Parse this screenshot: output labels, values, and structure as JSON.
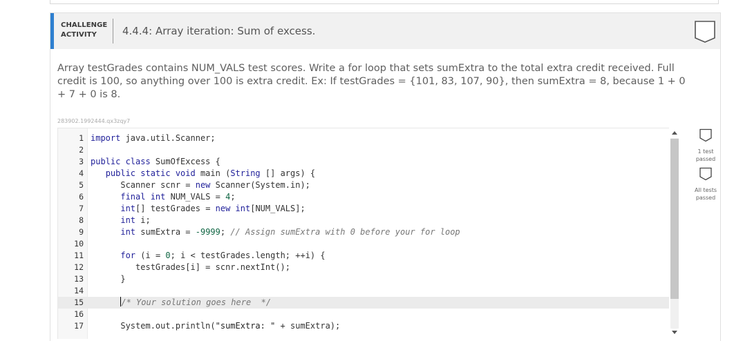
{
  "activity": {
    "type_line1": "CHALLENGE",
    "type_line2": "ACTIVITY",
    "title": "4.4.4: Array iteration: Sum of excess."
  },
  "description": "Array testGrades contains NUM_VALS test scores. Write a for loop that sets sumExtra to the total extra credit received. Full credit is 100, so anything over 100 is extra credit. Ex: If testGrades = {101, 83, 107, 90}, then sumExtra = 8, because 1 + 0 + 7 + 0 is 8.",
  "challenge_id": "283902.1992444.qx3zqy7",
  "editor": {
    "line_numbers": [
      "1",
      "2",
      "3",
      "4",
      "5",
      "6",
      "7",
      "8",
      "9",
      "10",
      "11",
      "12",
      "13",
      "14",
      "15",
      "16",
      "17"
    ],
    "active_line": 15
  },
  "tests": [
    {
      "label_line1": "1 test",
      "label_line2": "passed"
    },
    {
      "label_line1": "All tests",
      "label_line2": "passed"
    }
  ],
  "icons": {
    "badge": "bookmark-shield-icon",
    "scroll_up": "triangle-up-icon",
    "scroll_down": "triangle-down-icon"
  },
  "colors": {
    "accent": "#2e7fd0",
    "keyword": "#1f1f99",
    "number": "#116644",
    "comment": "#777777"
  }
}
